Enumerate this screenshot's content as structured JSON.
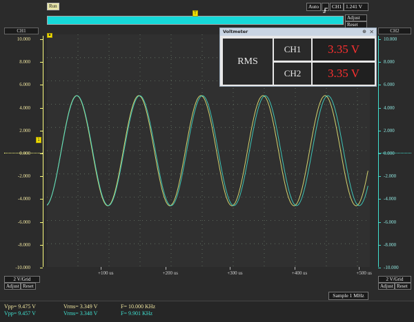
{
  "top": {
    "run_label": "Run",
    "trigger_mode": "Auto",
    "trigger_slope_icon": "rising-edge-icon",
    "trigger_source": "CH1",
    "trigger_level": "1.241 V",
    "adjust_label": "Adjust",
    "reset_label": "Reset",
    "trigger_marker": "T",
    "buffer_bar_color": "#16d9d9"
  },
  "ch1_axis": {
    "title": "CH1",
    "ticks": [
      "10.000",
      "8.000",
      "6.000",
      "4.000",
      "2.000",
      "0.000",
      "-2.000",
      "-4.000",
      "-6.000",
      "-8.000",
      "-10.000"
    ],
    "volts_div": "2 V/Grid",
    "adjust_label": "Adjust",
    "reset_label": "Reset",
    "ground_marker": "1",
    "color": "#ffff80"
  },
  "ch2_axis": {
    "title": "CH2",
    "ticks": [
      "10.000",
      "8.000",
      "6.000",
      "4.000",
      "2.000",
      "0.000",
      "-2.000",
      "-4.000",
      "-6.000",
      "-8.000",
      "-10.000"
    ],
    "volts_div": "2 V/Grid",
    "adjust_label": "Adjust",
    "reset_label": "Reset",
    "color": "#40e0d0"
  },
  "time_axis": {
    "ticks": [
      "+100 us",
      "+200 us",
      "+300 us",
      "+400 us",
      "+500 us"
    ]
  },
  "chart_data": {
    "type": "line",
    "x_unit": "us",
    "y_unit": "V",
    "xlim": [
      0,
      520
    ],
    "ylim": [
      -10,
      10
    ],
    "grid": true,
    "series": [
      {
        "name": "CH1",
        "color": "#ffff80",
        "amplitude": 4.7375,
        "frequency_khz": 10.0
      },
      {
        "name": "CH2",
        "color": "#40e0d0",
        "amplitude": 4.7285,
        "frequency_khz": 9.901
      }
    ]
  },
  "voltmeter": {
    "title": "Voltmeter",
    "pin_icon": "pin-icon",
    "close_icon": "close-icon",
    "mode": "RMS",
    "ch1_label": "CH1",
    "ch1_value": "3.35 V",
    "ch2_label": "CH2",
    "ch2_value": "3.35 V"
  },
  "status": {
    "sample_rate": "Sample 1 MHz",
    "ch1_vpp": "Vpp= 9.475 V",
    "ch2_vpp": "Vpp= 9.457 V",
    "ch1_vrms": "Vrms= 3.349 V",
    "ch2_vrms": "Vrms= 3.348 V",
    "ch1_freq": "F= 10.000 KHz",
    "ch2_freq": "F= 9.901 KHz"
  }
}
